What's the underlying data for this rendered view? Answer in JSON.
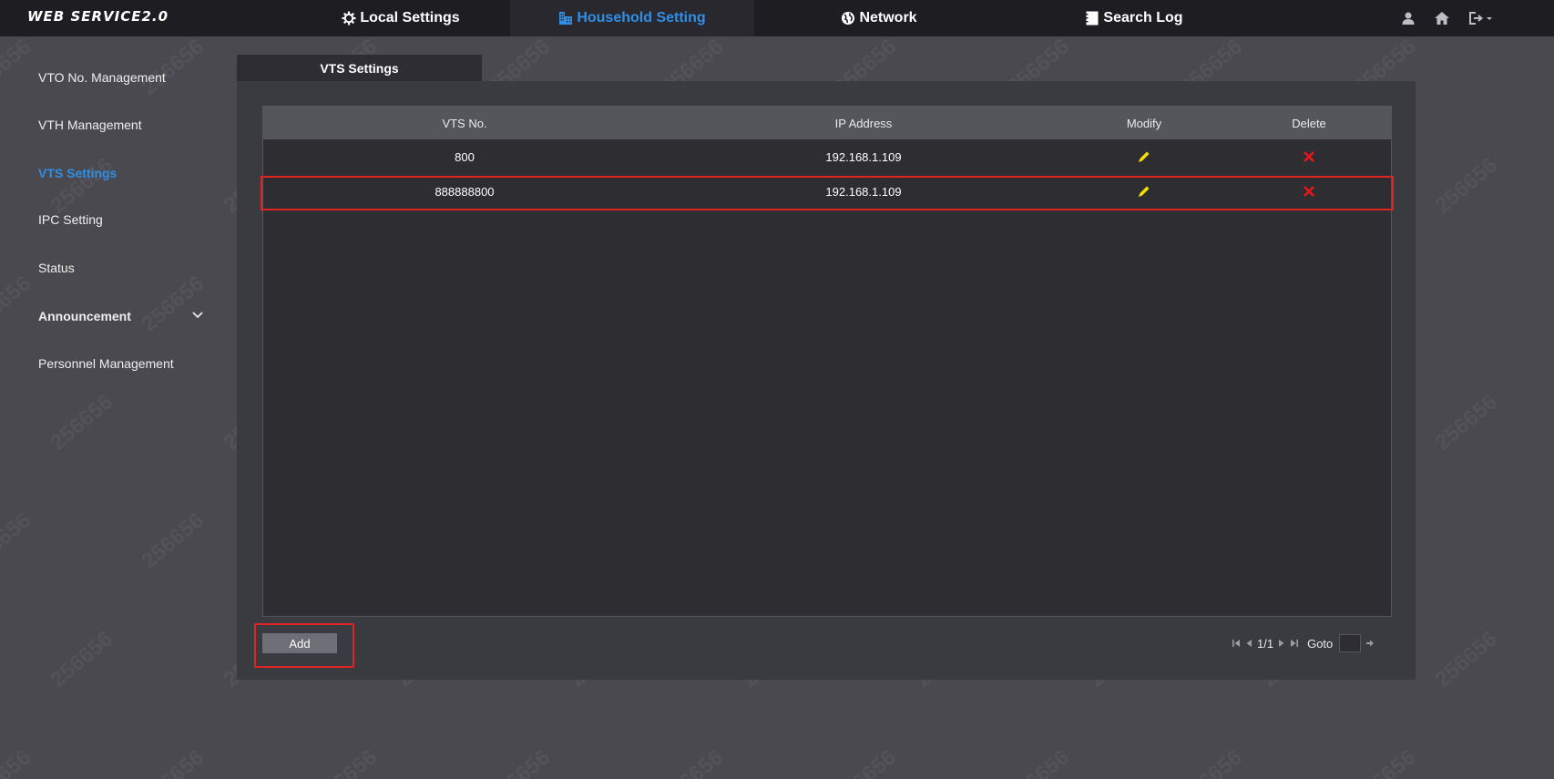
{
  "brand": "WEB SERVICE2.0",
  "nav": {
    "local_settings": "Local Settings",
    "household_setting": "Household Setting",
    "network": "Network",
    "search_log": "Search Log"
  },
  "sidebar": {
    "items": [
      {
        "label": "VTO No. Management"
      },
      {
        "label": "VTH Management"
      },
      {
        "label": "VTS Settings"
      },
      {
        "label": "IPC Setting"
      },
      {
        "label": "Status"
      },
      {
        "label": "Announcement"
      },
      {
        "label": "Personnel Management"
      }
    ]
  },
  "panel": {
    "tab_label": "VTS Settings",
    "columns": [
      "VTS No.",
      "IP Address",
      "Modify",
      "Delete"
    ],
    "rows": [
      {
        "vts_no": "800",
        "ip": "192.168.1.109"
      },
      {
        "vts_no": "888888800",
        "ip": "192.168.1.109"
      }
    ],
    "add_label": "Add"
  },
  "pager": {
    "page": "1/1",
    "goto_label": "Goto",
    "goto_value": ""
  },
  "watermark": "256656",
  "colors": {
    "accent": "#2f8fe6",
    "highlight": "#e02424",
    "modify_icon": "#f5e000",
    "delete_icon": "#e8171b"
  }
}
